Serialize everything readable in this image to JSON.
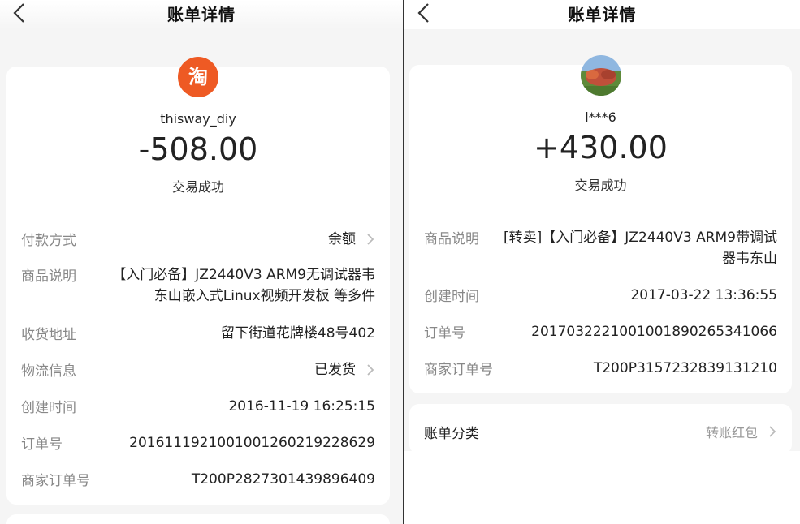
{
  "left": {
    "nav_title": "账单详情",
    "avatar_char": "淘",
    "merchant": "thisway_diy",
    "amount": "-508.00",
    "status": "交易成功",
    "rows": [
      {
        "label": "付款方式",
        "value": "余额"
      },
      {
        "label": "商品说明",
        "value_line1": "【入门必备】JZ2440V3 ARM9无调试器韦",
        "value_line2": "东山嵌入式Linux视频开发板 等多件"
      },
      {
        "label": "收货地址",
        "value": "留下街道花牌楼48号402"
      },
      {
        "label": "物流信息",
        "value": "已发货"
      },
      {
        "label": "创建时间",
        "value": "2016-11-19 16:25:15"
      },
      {
        "label": "订单号",
        "value": "2016111921001001260219228629"
      },
      {
        "label": "商家订单号",
        "value": "T200P2827301439896409"
      }
    ]
  },
  "right": {
    "nav_title": "账单详情",
    "merchant": "l***6",
    "amount": "+430.00",
    "status": "交易成功",
    "rows": [
      {
        "label": "商品说明",
        "value_line1": "[转卖]【入门必备】JZ2440V3 ARM9带调试",
        "value_line2": "器韦东山"
      },
      {
        "label": "创建时间",
        "value": "2017-03-22 13:36:55"
      },
      {
        "label": "订单号",
        "value": "2017032221001001890265341066"
      },
      {
        "label": "商家订单号",
        "value": "T200P3157232839131210"
      }
    ],
    "category": {
      "label": "账单分类",
      "value": "转账红包"
    }
  },
  "colors": {
    "taobao_orange": "#ee5a24",
    "page_bg": "#f5f5f5",
    "label_gray": "#888888"
  },
  "icons": [
    "back-arrow-icon",
    "chevron-right-icon",
    "taobao-logo-icon"
  ]
}
